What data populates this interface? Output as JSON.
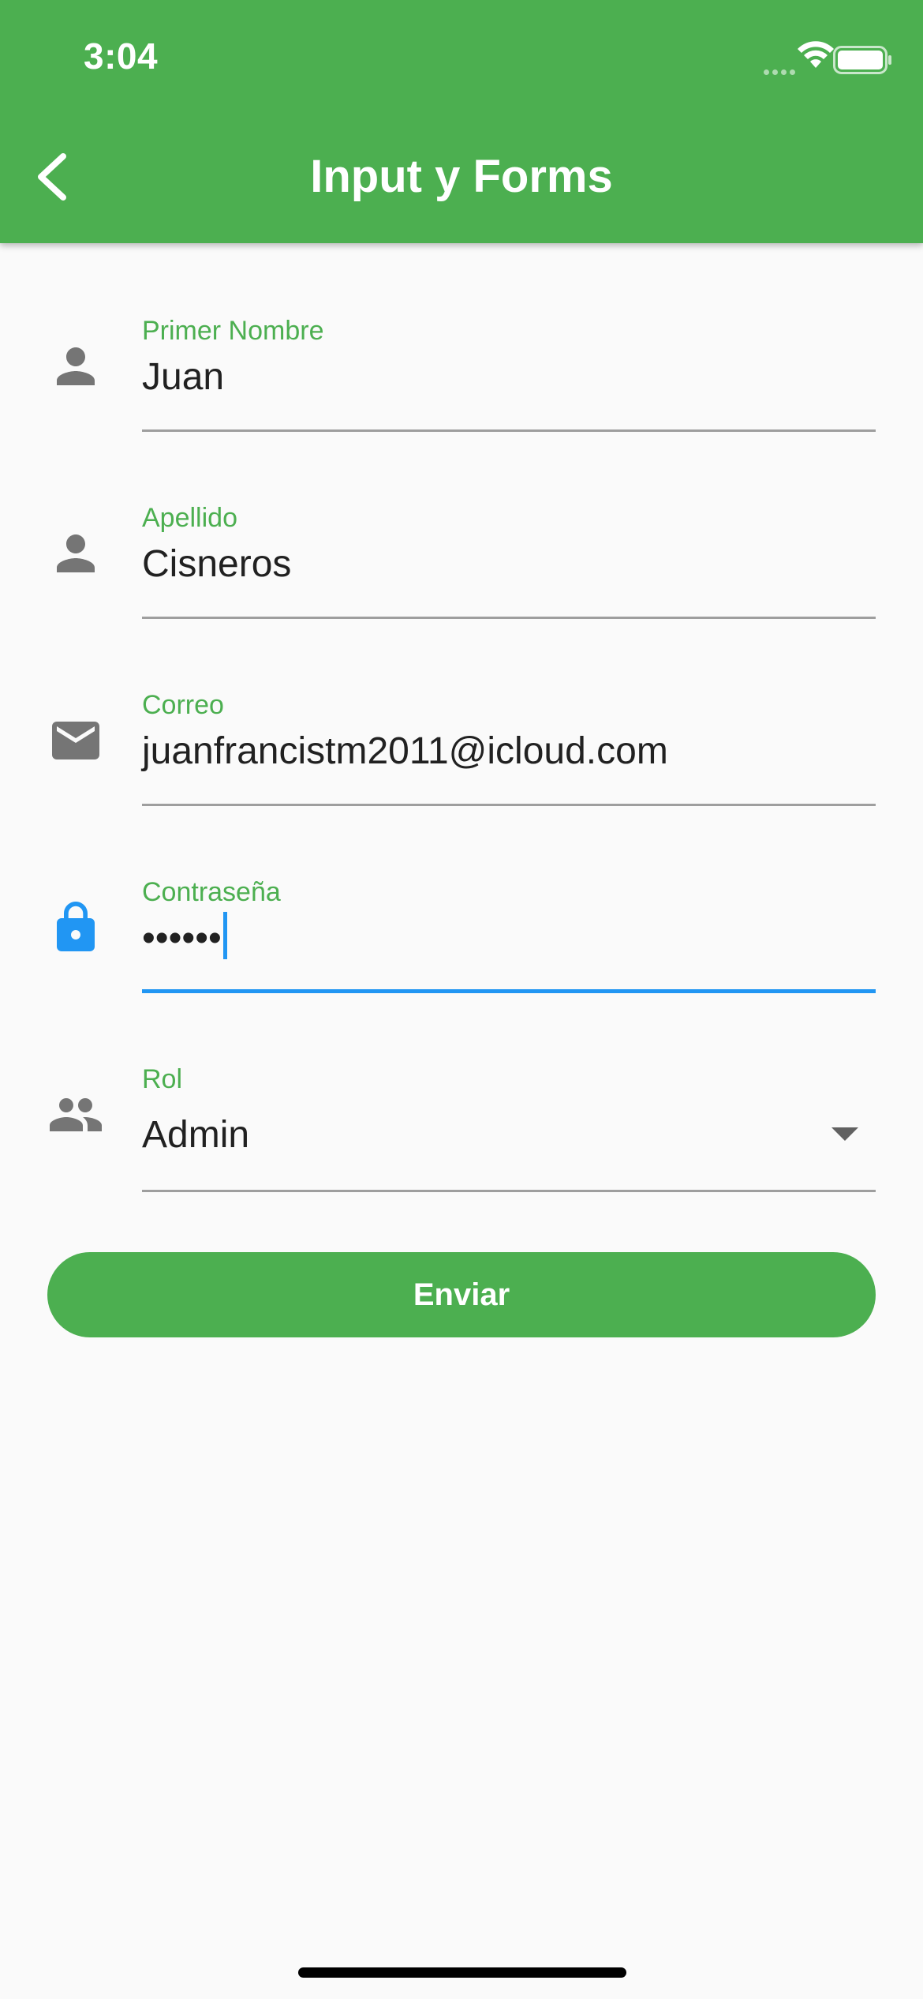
{
  "status_bar": {
    "time": "3:04"
  },
  "app_bar": {
    "title": "Input y Forms"
  },
  "form": {
    "first_name": {
      "label": "Primer Nombre",
      "value": "Juan"
    },
    "last_name": {
      "label": "Apellido",
      "value": "Cisneros"
    },
    "email": {
      "label": "Correo",
      "value": "juanfrancistm2011@icloud.com"
    },
    "password": {
      "label": "Contraseña",
      "value": "••••••"
    },
    "role": {
      "label": "Rol",
      "value": "Admin"
    },
    "submit_label": "Enviar"
  },
  "colors": {
    "primary": "#4caf50",
    "focus": "#2196f3",
    "icon": "#757575"
  },
  "icons": [
    "back-arrow-icon",
    "person-icon",
    "person-icon",
    "email-icon",
    "lock-icon",
    "people-icon",
    "dropdown-arrow-icon"
  ]
}
